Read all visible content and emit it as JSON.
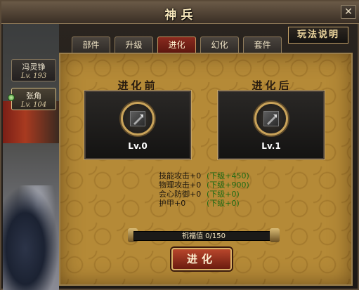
{
  "window": {
    "title": "神兵",
    "close_label": "✕"
  },
  "guide_button": "玩法说明",
  "characters": [
    {
      "name": "冯灵铮",
      "level": "Lv. 193"
    },
    {
      "name": "张角",
      "level": "Lv. 104"
    }
  ],
  "tabs": [
    "部件",
    "升级",
    "进化",
    "幻化",
    "套件"
  ],
  "active_tab": "进化",
  "before": {
    "header": "进化前",
    "level": "Lv.0"
  },
  "after": {
    "header": "进化后",
    "level": "Lv.1"
  },
  "stats": [
    {
      "name": "技能攻击+0",
      "delta": "(下级+450)"
    },
    {
      "name": "物理攻击+0",
      "delta": "(下级+900)"
    },
    {
      "name": "会心防御+0",
      "delta": "(下级+0)"
    },
    {
      "name": "护甲+0",
      "delta": "(下级+0)"
    }
  ],
  "blessing": {
    "text": "祝福值 0/150",
    "current": 0,
    "max": 150
  },
  "evolve_button": "进化",
  "colors": {
    "active_tab": "#8a2a1e",
    "stat_delta": "#1e6b14",
    "panel": "#b58a37"
  }
}
